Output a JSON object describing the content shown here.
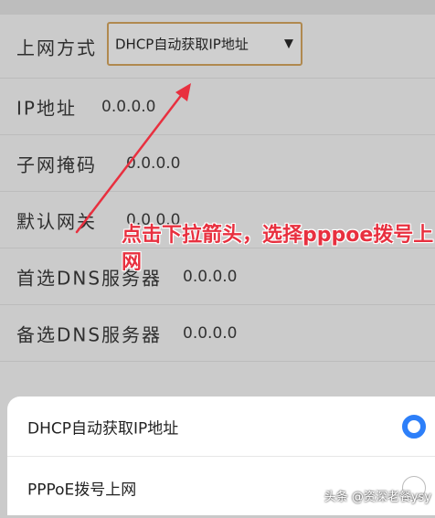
{
  "settings": {
    "connection_type": {
      "label": "上网方式",
      "selected": "DHCP自动获取IP地址"
    },
    "rows": [
      {
        "label": "IP地址",
        "value": "0.0.0.0"
      },
      {
        "label": "子网掩码",
        "value": "0.0.0.0"
      },
      {
        "label": "默认网关",
        "value": "0.0.0.0"
      },
      {
        "label": "首选DNS服务器",
        "value": "0.0.0.0"
      },
      {
        "label": "备选DNS服务器",
        "value": "0.0.0.0"
      }
    ]
  },
  "annotation": {
    "text": "点击下拉箭头，选择pppoe拨号上网",
    "color": "#e8303f"
  },
  "sheet": {
    "options": [
      {
        "label": "DHCP自动获取IP地址",
        "checked": true
      },
      {
        "label": "PPPoE拨号上网",
        "checked": false
      }
    ],
    "accent_color": "#2d7ff9"
  },
  "watermark": "头条 @资深老餐ysy",
  "icons": {
    "dropdown": "▼"
  }
}
